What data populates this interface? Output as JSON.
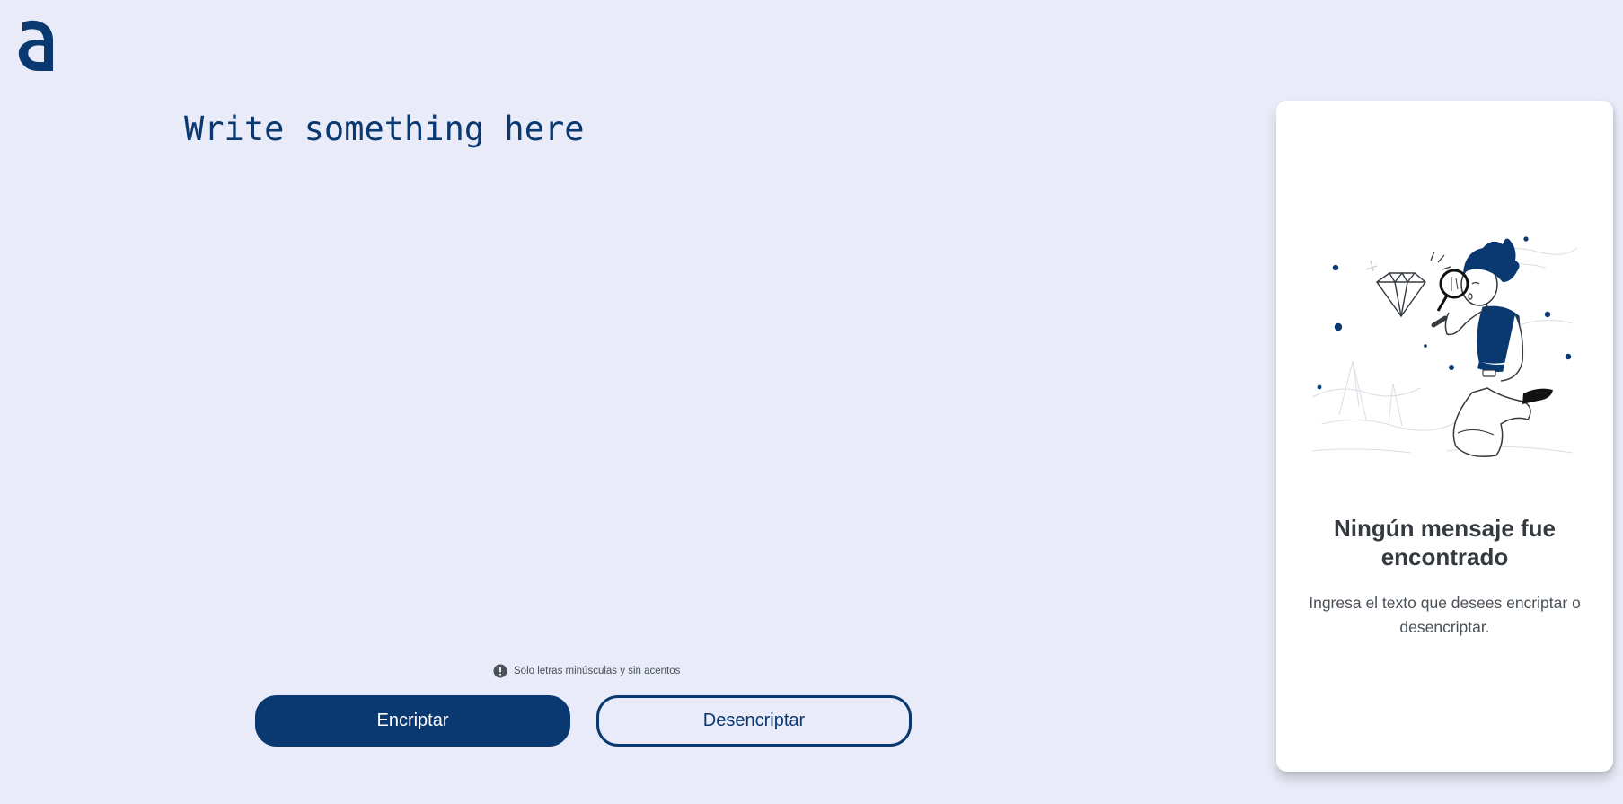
{
  "logo": {
    "icon": "alura-a-logo-icon",
    "color": "#0a3871"
  },
  "input": {
    "placeholder": "Write something here",
    "value": ""
  },
  "hint": {
    "icon": "exclamation-circle-icon",
    "text": "Solo letras minúsculas y sin acentos"
  },
  "buttons": {
    "encrypt_label": "Encriptar",
    "decrypt_label": "Desencriptar"
  },
  "output": {
    "illustration": "person-with-magnifying-glass-illustration",
    "title": "Ningún mensaje fue encontrado",
    "text": "Ingresa el texto que desees encriptar o desencriptar."
  },
  "colors": {
    "background": "#e9ecf8",
    "accent": "#0a3871",
    "panel": "#ffffff",
    "title_text": "#343a40",
    "body_text": "#495057"
  }
}
